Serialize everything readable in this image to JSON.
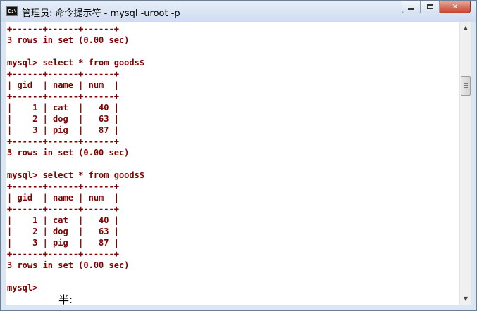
{
  "window": {
    "title": "管理员: 命令提示符 - mysql  -uroot -p",
    "icon_text": "C:\\"
  },
  "controls": {
    "minimize_icon": "minimize-icon",
    "maximize_icon": "maximize-icon",
    "close_label": "✕"
  },
  "console": {
    "lines": [
      "+------+------+------+",
      "3 rows in set (0.00 sec)",
      "",
      "mysql> select * from goods$",
      "+------+------+------+",
      "| gid  | name | num  |",
      "+------+------+------+",
      "|    1 | cat  |   40 |",
      "|    2 | dog  |   63 |",
      "|    3 | pig  |   87 |",
      "+------+------+------+",
      "3 rows in set (0.00 sec)",
      "",
      "mysql> select * from goods$",
      "+------+------+------+",
      "| gid  | name | num  |",
      "+------+------+------+",
      "|    1 | cat  |   40 |",
      "|    2 | dog  |   63 |",
      "|    3 | pig  |   87 |",
      "+------+------+------+",
      "3 rows in set (0.00 sec)",
      "",
      "mysql>"
    ],
    "ime_composition": "半:",
    "text_color": "#800000",
    "background_color": "#ffffff"
  },
  "scrollbar": {
    "up_arrow": "▲",
    "down_arrow": "▼"
  }
}
